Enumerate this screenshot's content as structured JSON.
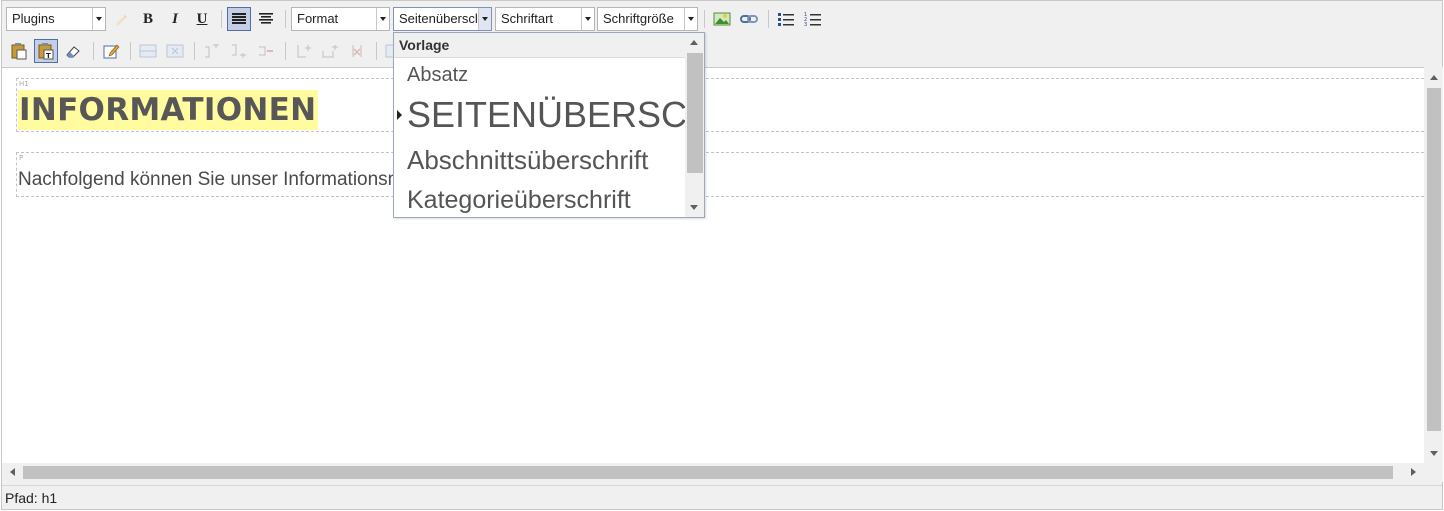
{
  "toolbar": {
    "plugins_select": "Plugins",
    "format_select": "Format",
    "style_select": "Seitenüberschrift",
    "font_select": "Schriftart",
    "size_select": "Schriftgröße",
    "bold_label": "B",
    "italic_label": "I",
    "underline_label": "U"
  },
  "dropdown": {
    "header": "Vorlage",
    "items": [
      {
        "label": "Absatz",
        "selected": false
      },
      {
        "label": "SEITENÜBERSCHRIFT",
        "selected": true
      },
      {
        "label": "Abschnittsüberschrift",
        "selected": false
      },
      {
        "label": "Kategorieüberschrift",
        "selected": false
      }
    ]
  },
  "content": {
    "h1_tag": "H1",
    "h1_text": "INFORMATIONEN",
    "p_tag": "P",
    "p_text": "Nachfolgend können Sie unser Informationsmaterial herunterladen."
  },
  "statusbar": {
    "path": "Pfad: h1"
  },
  "colors": {
    "highlight": "#fffb9e",
    "active_button": "#c5cee4",
    "toolbar_bg": "#f0f0f0"
  }
}
